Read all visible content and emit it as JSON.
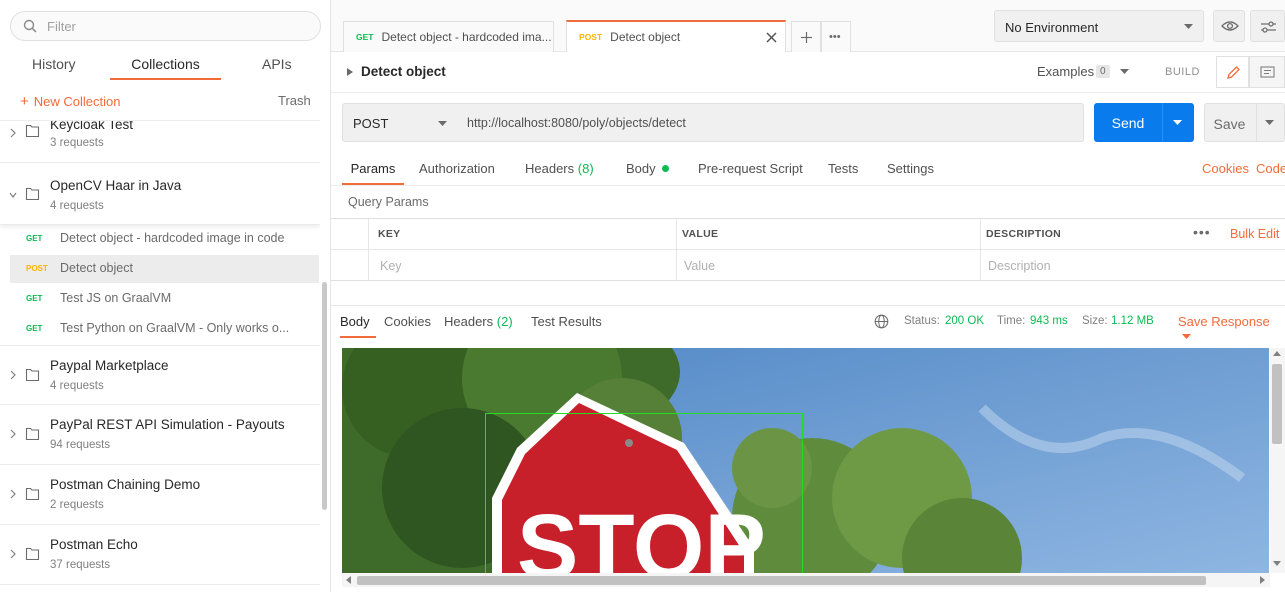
{
  "sidebar": {
    "filter_placeholder": "Filter",
    "tabs": [
      {
        "label": "History"
      },
      {
        "label": "Collections"
      },
      {
        "label": "APIs"
      }
    ],
    "new_collection": "New Collection",
    "trash": "Trash",
    "collections": [
      {
        "name": "Keycloak Test",
        "count": "3 requests"
      },
      {
        "name": "OpenCV Haar in Java",
        "count": "4 requests"
      },
      {
        "name": "Paypal Marketplace",
        "count": "4 requests"
      },
      {
        "name": "PayPal REST API Simulation - Payouts",
        "count": "94 requests"
      },
      {
        "name": "Postman Chaining Demo",
        "count": "2 requests"
      },
      {
        "name": "Postman Echo",
        "count": "37 requests"
      }
    ],
    "requests": [
      {
        "method": "GET",
        "name": "Detect object - hardcoded image in code"
      },
      {
        "method": "POST",
        "name": "Detect object"
      },
      {
        "method": "GET",
        "name": "Test JS on GraalVM"
      },
      {
        "method": "GET",
        "name": "Test Python on GraalVM - Only works o..."
      }
    ]
  },
  "tabs": [
    {
      "method": "GET",
      "label": "Detect object - hardcoded ima..."
    },
    {
      "method": "POST",
      "label": "Detect object"
    }
  ],
  "environment": {
    "selected": "No Environment"
  },
  "request": {
    "title": "Detect object",
    "examples_label": "Examples",
    "examples_count": "0",
    "build_label": "BUILD",
    "method": "POST",
    "url": "http://localhost:8080/poly/objects/detect",
    "send_label": "Send",
    "save_label": "Save"
  },
  "param_tabs": {
    "params": "Params",
    "authorization": "Authorization",
    "headers": "Headers",
    "headers_count": "(8)",
    "body": "Body",
    "prerequest": "Pre-request Script",
    "tests": "Tests",
    "settings": "Settings",
    "cookies": "Cookies",
    "code": "Code"
  },
  "query_params": {
    "title": "Query Params",
    "col_key": "KEY",
    "col_value": "VALUE",
    "col_description": "DESCRIPTION",
    "key_placeholder": "Key",
    "value_placeholder": "Value",
    "description_placeholder": "Description",
    "bulk_edit": "Bulk Edit"
  },
  "response": {
    "tabs": {
      "body": "Body",
      "cookies": "Cookies",
      "headers": "Headers",
      "headers_count": "(2)",
      "test_results": "Test Results"
    },
    "status_label": "Status:",
    "status_value": "200 OK",
    "time_label": "Time:",
    "time_value": "943 ms",
    "size_label": "Size:",
    "size_value": "1.12 MB",
    "save_response": "Save Response",
    "image_text": "STOP"
  },
  "colors": {
    "accent": "#f26b3a",
    "send": "#097bed",
    "get": "#0cbb52",
    "post": "#ffb400"
  }
}
